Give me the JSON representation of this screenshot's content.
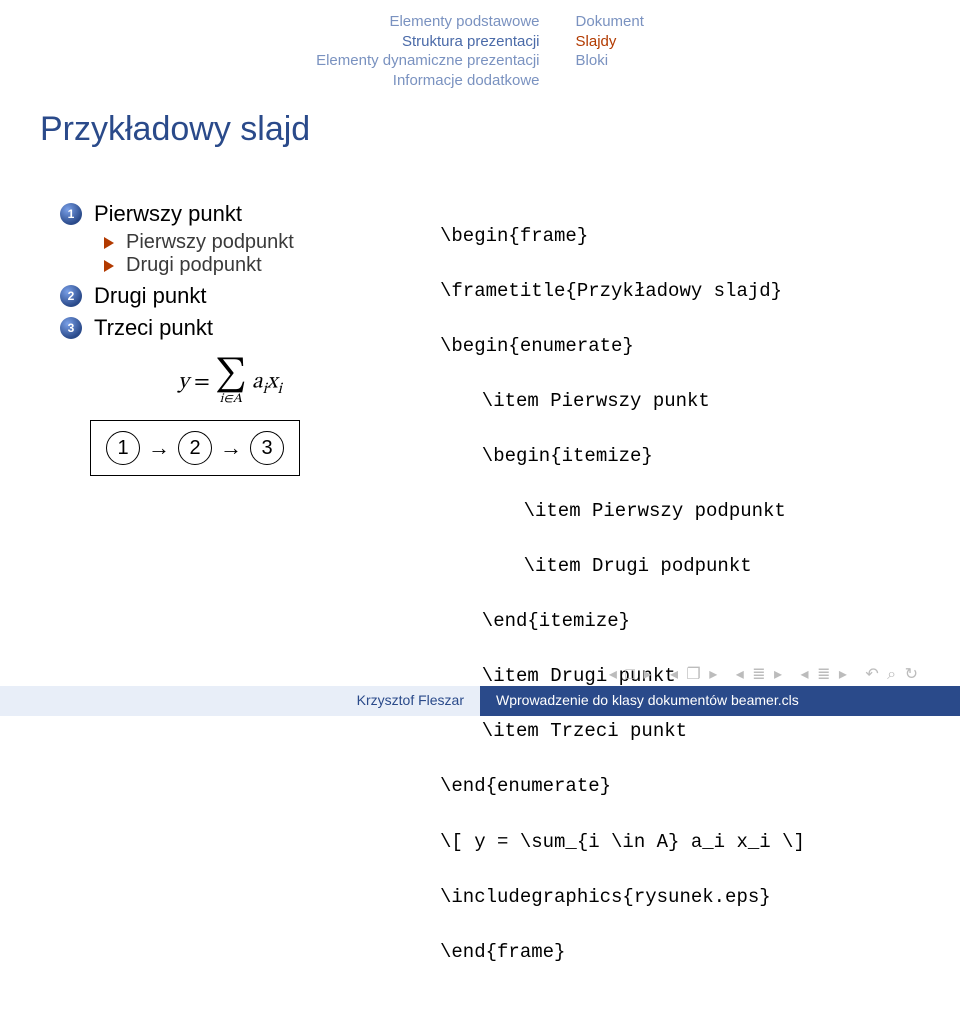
{
  "header": {
    "left": [
      "Elementy podstawowe",
      "Struktura prezentacji",
      "Elementy dynamiczne prezentacji",
      "Informacje dodatkowe"
    ],
    "left_active_index": 1,
    "right": [
      "Dokument",
      "Slajdy",
      "Bloki"
    ],
    "right_active_index": 1
  },
  "frametitle": "Przykładowy slajd",
  "left_panel": {
    "enum": [
      {
        "n": "1",
        "label": "Pierwszy punkt",
        "sub": [
          "Pierwszy podpunkt",
          "Drugi podpunkt"
        ]
      },
      {
        "n": "2",
        "label": "Drugi punkt",
        "sub": []
      },
      {
        "n": "3",
        "label": "Trzeci punkt",
        "sub": []
      }
    ],
    "equation": {
      "lhs": "y",
      "eq": "=",
      "sigma": "∑",
      "sub": "i∈A",
      "term_a": "a",
      "term_x": "x",
      "idx": "i"
    },
    "diagram": [
      "1",
      "2",
      "3"
    ],
    "arrow": "→"
  },
  "code": {
    "l1": "\\begin{frame}",
    "l2": "\\frametitle{Przykładowy slajd}",
    "l3": "\\begin{enumerate}",
    "l4": "\\item Pierwszy punkt",
    "l5": "\\begin{itemize}",
    "l6": "\\item Pierwszy podpunkt",
    "l7": "\\item Drugi podpunkt",
    "l8": "\\end{itemize}",
    "l9": "\\item Drugi punkt",
    "l10": "\\item Trzeci punkt",
    "l11": "\\end{enumerate}",
    "l12": "\\[ y = \\sum_{i \\in A} a_i x_i \\]",
    "l13": "\\includegraphics{rysunek.eps}",
    "l14": "\\end{frame}"
  },
  "footer": {
    "author": "Krzysztof Fleszar",
    "title": "Wprowadzenie do klasy dokumentów beamer.cls",
    "nav": {
      "frame": "◂ □ ▸",
      "subsec": "◂ ❐ ▸",
      "sec": "◂ ≣ ▸",
      "slide": "◂ ≣ ▸",
      "back": "↶",
      "search": "⌕",
      "undo": "↻"
    }
  }
}
